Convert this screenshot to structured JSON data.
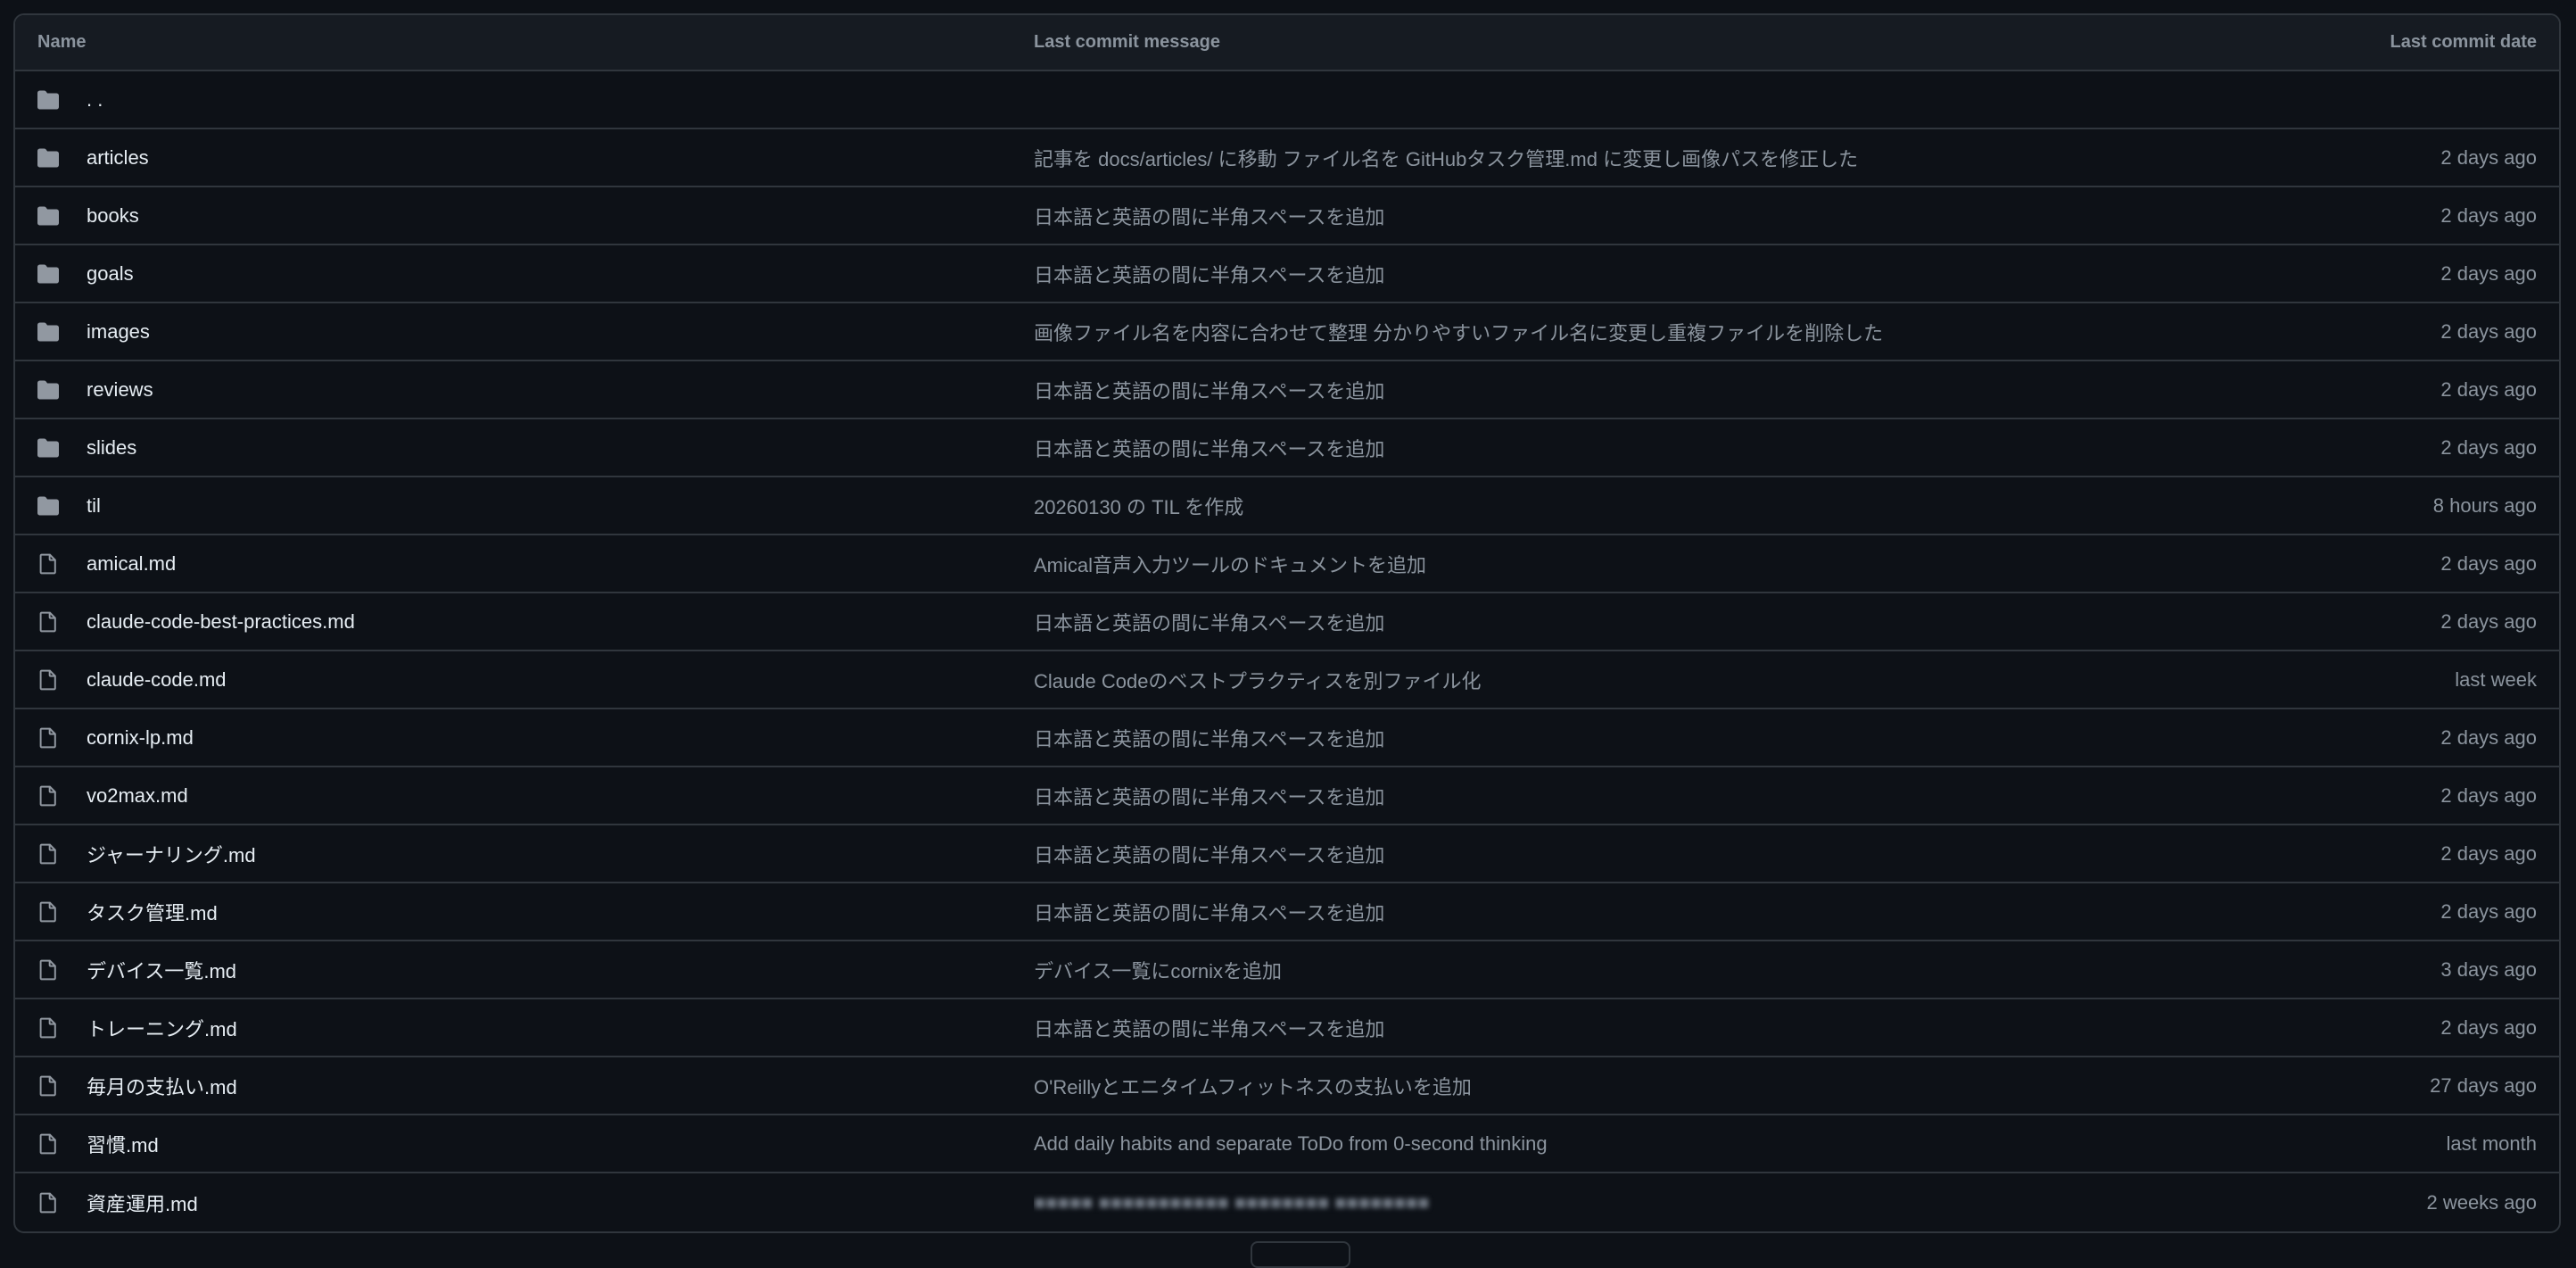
{
  "table": {
    "headers": {
      "name": "Name",
      "message": "Last commit message",
      "date": "Last commit date"
    },
    "parent": {
      "name": ". .",
      "icon": "folder-icon"
    },
    "rows": [
      {
        "name": "articles",
        "type": "folder",
        "icon": "folder-icon",
        "message": "記事を docs/articles/ に移動 ファイル名を GitHubタスク管理.md に変更し画像パスを修正した",
        "date": "2 days ago"
      },
      {
        "name": "books",
        "type": "folder",
        "icon": "folder-icon",
        "message": "日本語と英語の間に半角スペースを追加",
        "date": "2 days ago"
      },
      {
        "name": "goals",
        "type": "folder",
        "icon": "folder-icon",
        "message": "日本語と英語の間に半角スペースを追加",
        "date": "2 days ago"
      },
      {
        "name": "images",
        "type": "folder",
        "icon": "folder-icon",
        "message": "画像ファイル名を内容に合わせて整理 分かりやすいファイル名に変更し重複ファイルを削除した",
        "date": "2 days ago"
      },
      {
        "name": "reviews",
        "type": "folder",
        "icon": "folder-icon",
        "message": "日本語と英語の間に半角スペースを追加",
        "date": "2 days ago"
      },
      {
        "name": "slides",
        "type": "folder",
        "icon": "folder-icon",
        "message": "日本語と英語の間に半角スペースを追加",
        "date": "2 days ago"
      },
      {
        "name": "til",
        "type": "folder",
        "icon": "folder-icon",
        "message": "20260130 の TIL を作成",
        "date": "8 hours ago"
      },
      {
        "name": "amical.md",
        "type": "file",
        "icon": "file-icon",
        "message": "Amical音声入力ツールのドキュメントを追加",
        "date": "2 days ago"
      },
      {
        "name": "claude-code-best-practices.md",
        "type": "file",
        "icon": "file-icon",
        "message": "日本語と英語の間に半角スペースを追加",
        "date": "2 days ago"
      },
      {
        "name": "claude-code.md",
        "type": "file",
        "icon": "file-icon",
        "message": "Claude Codeのベストプラクティスを別ファイル化",
        "date": "last week"
      },
      {
        "name": "cornix-lp.md",
        "type": "file",
        "icon": "file-icon",
        "message": "日本語と英語の間に半角スペースを追加",
        "date": "2 days ago"
      },
      {
        "name": "vo2max.md",
        "type": "file",
        "icon": "file-icon",
        "message": "日本語と英語の間に半角スペースを追加",
        "date": "2 days ago"
      },
      {
        "name": "ジャーナリング.md",
        "type": "file",
        "icon": "file-icon",
        "message": "日本語と英語の間に半角スペースを追加",
        "date": "2 days ago"
      },
      {
        "name": "タスク管理.md",
        "type": "file",
        "icon": "file-icon",
        "message": "日本語と英語の間に半角スペースを追加",
        "date": "2 days ago"
      },
      {
        "name": "デバイス一覧.md",
        "type": "file",
        "icon": "file-icon",
        "message": "デバイス一覧にcornixを追加",
        "date": "3 days ago"
      },
      {
        "name": "トレーニング.md",
        "type": "file",
        "icon": "file-icon",
        "message": "日本語と英語の間に半角スペースを追加",
        "date": "2 days ago"
      },
      {
        "name": "毎月の支払い.md",
        "type": "file",
        "icon": "file-icon",
        "message": "O'Reillyとエニタイムフィットネスの支払いを追加",
        "date": "27 days ago"
      },
      {
        "name": "習慣.md",
        "type": "file",
        "icon": "file-icon",
        "message": "Add daily habits and separate ToDo from 0-second thinking",
        "date": "last month"
      },
      {
        "name": "資産運用.md",
        "type": "file",
        "icon": "file-icon",
        "message": "",
        "message_redacted": true,
        "date": "2 weeks ago"
      }
    ]
  },
  "colors": {
    "background": "#0d1117",
    "header_background": "#161b22",
    "border": "#30363d",
    "text_primary": "#e6edf3",
    "text_muted": "#8b949e",
    "icon": "#9198a1"
  }
}
